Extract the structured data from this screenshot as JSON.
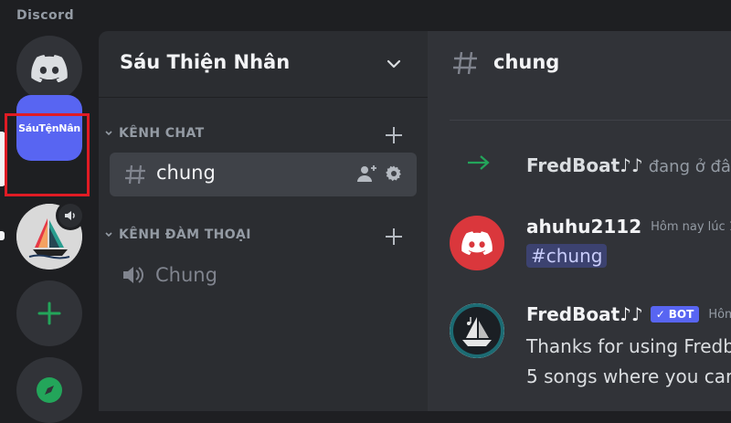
{
  "app": {
    "brand": "Discord"
  },
  "rail": {
    "active_server_label": "SáuTệnNân",
    "colors": {
      "brand": "#5865f2",
      "highlight": "#e01b24",
      "green": "#23a55a"
    }
  },
  "channels": {
    "server_name": "Sáu Thiện Nhân",
    "categories": [
      {
        "label": "KÊNH CHAT"
      },
      {
        "label": "KÊNH ĐÀM THOẠI"
      }
    ],
    "text_channel": "chung",
    "voice_channel": "Chung"
  },
  "chat": {
    "title": "chung",
    "join_message": {
      "name": "FredBoat♪♪",
      "text": "đang ở đâ"
    },
    "messages": [
      {
        "author": "ahuhu2112",
        "timestamp": "Hôm nay lúc 1",
        "mention": "#chung"
      },
      {
        "author": "FredBoat♪♪",
        "bot_tag": "BOT",
        "timestamp": "Hôm",
        "lines": [
          "Thanks for using Fredb",
          "5 songs where you car"
        ]
      }
    ]
  }
}
